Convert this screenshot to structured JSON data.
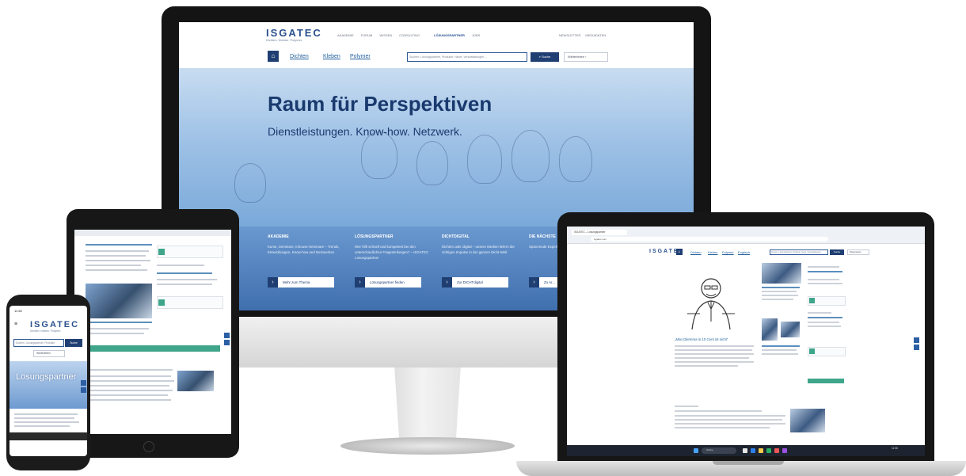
{
  "brand": {
    "logo": "ISGATEC",
    "tagline": "Dichten. Kleben. Polymer."
  },
  "desktop": {
    "nav": [
      "AKADEMIE",
      "FORUM",
      "WISSEN",
      "CONSULTING",
      "LÖSUNGSPARTNER",
      "JOBS"
    ],
    "utility": [
      "NEWSLETTER",
      "MEDIADATEN"
    ],
    "tabs": [
      "Dichten",
      "Kleben",
      "Polymer"
    ],
    "search_placeholder": "Suchen: Lösungspartner, Produkte, News, Veranstaltungen ...",
    "search_button": "Suche",
    "more_button": "Weiterleiten",
    "hero_title": "Raum für Perspektiven",
    "hero_subtitle": "Dienstleistungen. Know-how. Netzwerk.",
    "cards": [
      {
        "title": "AKADEMIE",
        "text": "Kurse, Seminare, Inhouse-Seminare – Trends, Entwicklungen, Know-how und Netzwerken",
        "button": "Mehr zum Thema"
      },
      {
        "title": "LÖSUNGSPARTNER",
        "text": "Wer hilft schnell und kompetent bei den unterschiedlichen Fragestellungen? – ISGATEC Lösungspartner",
        "button": "Lösungspartner finden"
      },
      {
        "title": "DICHTDIGITAL",
        "text": "Dichten oder digital – unsere Medien liefern die richtigen Impulse in der ganzen Dicht-Welt",
        "button": "Zur DICHTdigital"
      },
      {
        "title": "DIE NÄCHSTE",
        "text": "Spannende Expertenaus...",
        "button": "Zu Ar..."
      }
    ]
  },
  "phone": {
    "time": "11:56",
    "search_placeholder": "Suchen: Lösungspartner, Produkte",
    "search_button": "Suche",
    "more_button": "Weiterleiten",
    "hero_title": "Lösungspartner"
  },
  "laptop": {
    "tab_title": "ISGATEC – Lösungspartner",
    "url": "isgatec.com",
    "tabs": [
      "Dichten",
      "Kleben",
      "Polymer",
      "Englisch"
    ],
    "search_placeholder": "Suchen: Lösungspartner, Produkte, News, Veranstaltungen",
    "search_button": "Suche",
    "more_button": "Weiterleiten",
    "article_title": "„Man Dilemma in 10 Cent ist nicht“",
    "taskbar_search": "Suche",
    "clock": "11:56"
  },
  "colors": {
    "brand_navy": "#1f3f73",
    "hero_blue": "#9fc2e6",
    "accent_green": "#3fa58b"
  }
}
